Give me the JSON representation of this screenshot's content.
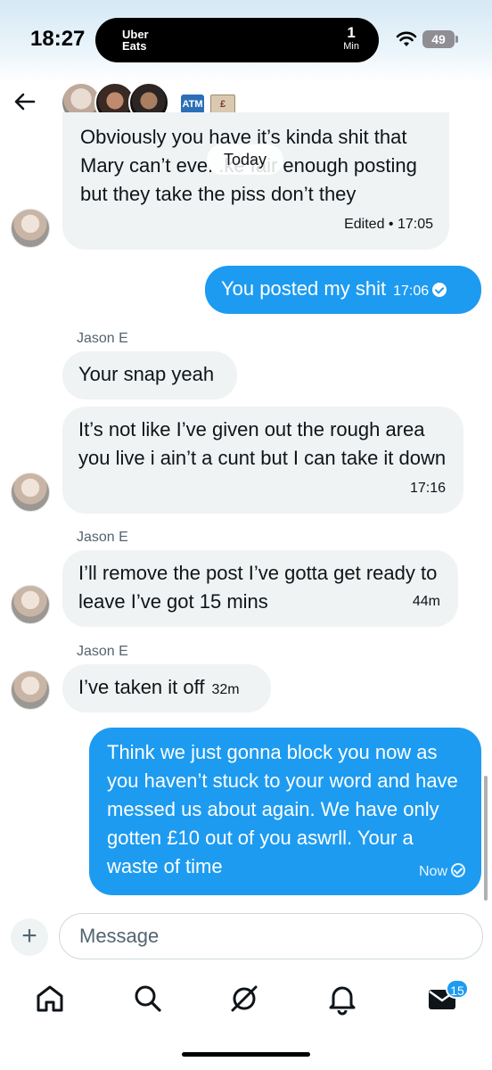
{
  "status_bar": {
    "time": "18:27",
    "live_activity_app": "Uber\nEats",
    "live_activity_count": "1",
    "live_activity_unit": "Min",
    "battery": "49"
  },
  "header": {
    "emoji_atm": "ATM",
    "emoji_money": "£"
  },
  "date_separator": "Today",
  "messages": [
    {
      "text": "Obviously you have it’s kinda shit that Mary can’t eve.      .ke fair enough posting but they take the piss don’t they",
      "meta": "Edited • 17:05"
    },
    {
      "text": "You posted my shit",
      "meta": "17:06"
    },
    {
      "sender": "Jason E",
      "text": "Your snap yeah"
    },
    {
      "text": "It’s not like I’ve given out the rough area you live i ain’t a cunt but I can take it down",
      "meta": "17:16"
    },
    {
      "sender": "Jason E",
      "text": "I’ll remove the post I’ve gotta get ready to leave I’ve got 15 mins",
      "meta": "44m"
    },
    {
      "sender": "Jason E",
      "text": "I’ve taken it off",
      "meta": "32m"
    },
    {
      "text": "Think we just gonna block you now as you haven’t stuck to your word and have messed us about again. We have only gotten £10 out of you aswrll. Your a waste of time",
      "meta": "Now"
    }
  ],
  "composer": {
    "plus": "+",
    "placeholder": "Message"
  },
  "tab_bar": {
    "items": [
      "home-icon",
      "search-icon",
      "grok-icon",
      "notifications-icon",
      "messages-icon"
    ],
    "messages_badge": "15"
  },
  "colors": {
    "accent": "#1d9bf0",
    "incoming_bubble": "#eff3f4"
  }
}
